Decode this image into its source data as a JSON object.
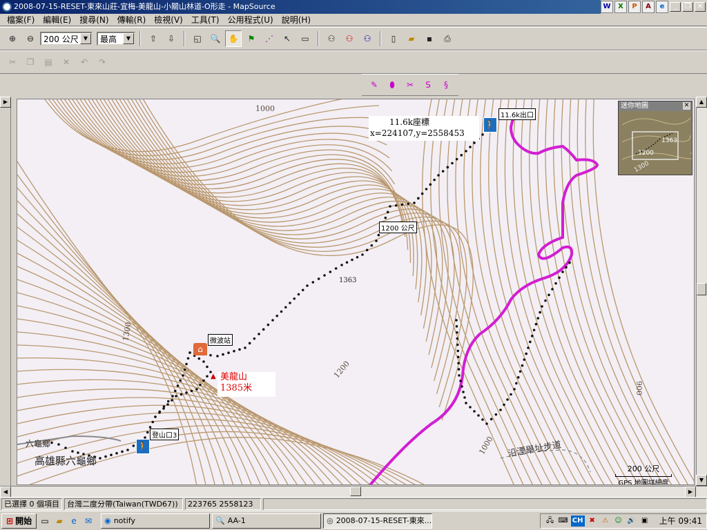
{
  "window": {
    "title": "2008-07-15-RESET-東來山莊-宜梅-美龍山-小關山林道-O形走 - MapSource",
    "buttons": [
      "_",
      "❐",
      "✕"
    ],
    "office_icons": [
      "W",
      "X",
      "P",
      "A",
      "e"
    ]
  },
  "menu": {
    "items": [
      "檔案(F)",
      "編輯(E)",
      "搜尋(N)",
      "傳輸(R)",
      "檢視(V)",
      "工具(T)",
      "公用程式(U)",
      "說明(H)"
    ]
  },
  "toolbar": {
    "zoom_value": "200 公尺",
    "detail_value": "最高"
  },
  "map": {
    "contour_labels": [
      {
        "text": "1000"
      },
      {
        "text": "1300"
      },
      {
        "text": "1200"
      },
      {
        "text": "1000"
      },
      {
        "text": "900"
      },
      {
        "text": "1363"
      },
      {
        "text": "1300"
      }
    ],
    "waypoints": {
      "exit": "11.6k出口",
      "coord_title": "11.6k座標",
      "coord_value": "x=224107,y=2558453",
      "route_1200": "1200 公尺",
      "spot_1363": "1363",
      "microwave": "微波站",
      "peak_name": "美龍山",
      "peak_height": "1385米",
      "entrance": "登山口3",
      "township_small": "六龜鄉",
      "township": "高雄縣六龜鄉",
      "trail": "沿湮舉址步道"
    },
    "scale": {
      "label": "200 公尺",
      "detail": "GPS 地圖詳細度"
    },
    "overview": {
      "title": "迷你地圖",
      "label_1363": "1363",
      "label_1200": "1200",
      "label_1300": "1300"
    }
  },
  "status": {
    "selection": "已選擇 0 個項目",
    "datum": "台灣二度分帶(Taiwan(TWD67))",
    "coords": "223765 2558123"
  },
  "taskbar": {
    "start": "開始",
    "tasks": [
      "notify",
      "AA-1",
      "2008-07-15-RESET-東來..."
    ],
    "tray_lang": "CH",
    "clock": "上午 09:41"
  },
  "colors": {
    "track_magenta": "#d21ed2",
    "contour": "#b9986e",
    "map_bg": "#f3eff5",
    "waypoint_blue": "#1c6fc0"
  }
}
